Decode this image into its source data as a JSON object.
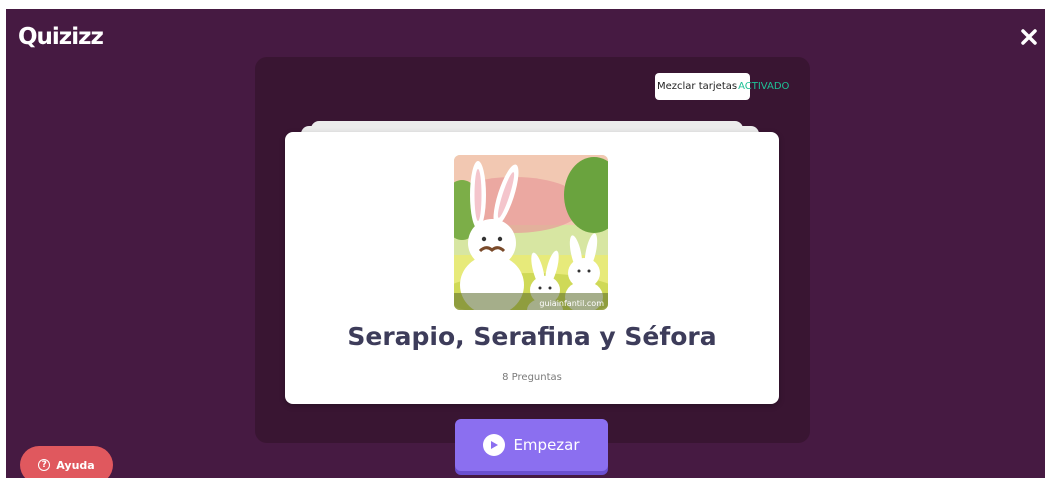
{
  "brand": {
    "logo_text": "Quizizz"
  },
  "header": {
    "close_icon": "close-icon"
  },
  "shuffle": {
    "label": "Mezclar tarjetas",
    "state": "ACTIVADO",
    "state_color": "#1ec196"
  },
  "quiz": {
    "title": "Serapio, Serafina y Séfora",
    "question_count": "8 Preguntas",
    "image_watermark": "guiainfantil.com",
    "image_icon": "bunny-family-illustration"
  },
  "actions": {
    "start_label": "Empezar",
    "help_label": "Ayuda"
  },
  "colors": {
    "background": "#461a42",
    "panel": "#391532",
    "start_button": "#8b6ff0",
    "help_button": "#e0585e",
    "title_text": "#3d3c5a"
  }
}
